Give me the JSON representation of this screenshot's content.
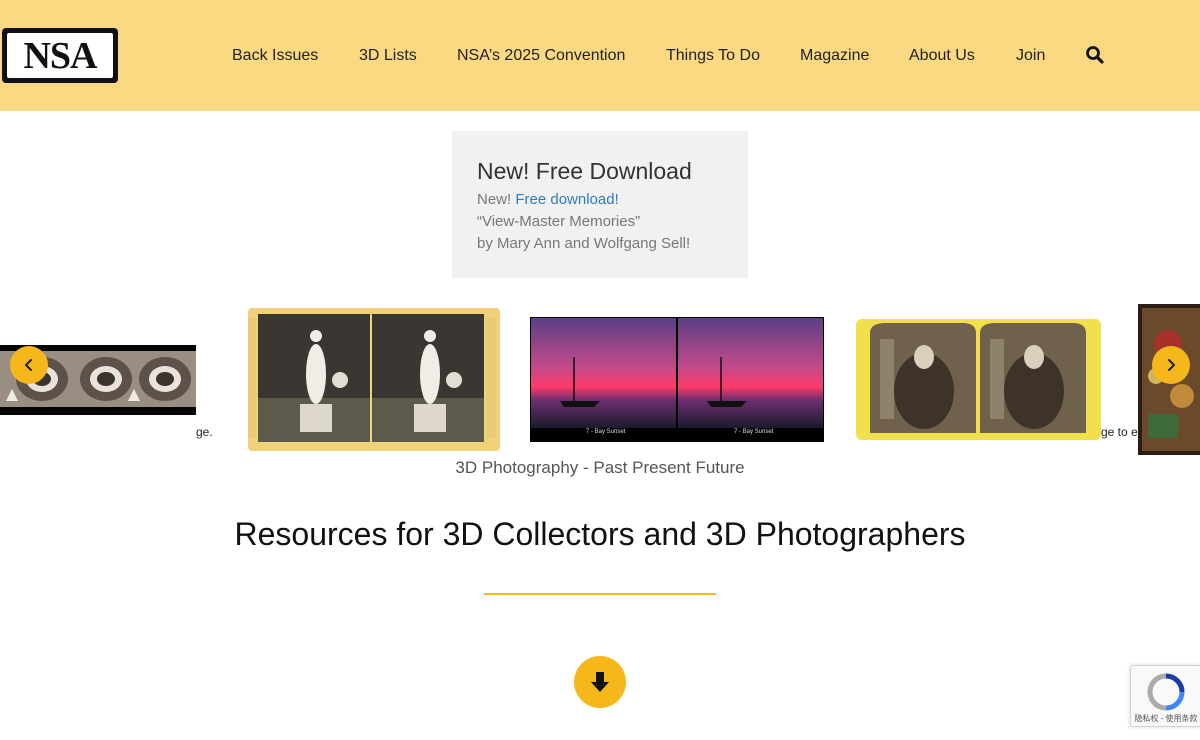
{
  "header": {
    "logo_text": "NSA",
    "nav": [
      {
        "label": "Back Issues"
      },
      {
        "label": "3D Lists"
      },
      {
        "label": "NSA’s 2025 Convention"
      },
      {
        "label": "Things To Do"
      },
      {
        "label": "Magazine"
      },
      {
        "label": "About Us"
      },
      {
        "label": "Join"
      }
    ],
    "search_icon": "search-icon"
  },
  "download": {
    "title": "New! Free Download",
    "line1_prefix": "New! ",
    "line1_link": "Free download!",
    "line2": "“View-Master Memories”",
    "line3": "by Mary Ann and Wolfgang Sell!"
  },
  "carousel": {
    "left_caption_fragment": "ge.",
    "right_caption_fragment": "ge to e",
    "caption": "3D Photography - Past Present Future",
    "prev_icon": "chevron-left-icon",
    "next_icon": "chevron-right-icon",
    "slide3_label_left": "7 - Bay Sunset",
    "slide3_label_right": "7 - Bay Sunset"
  },
  "main": {
    "heading": "Resources for 3D Collectors and 3D Photographers",
    "down_icon": "arrow-down-icon"
  },
  "recaptcha": {
    "text": "隐私权 - 使用条款"
  },
  "colors": {
    "header_bg": "#fbd983",
    "accent": "#f5b719",
    "link": "#2f7bbf"
  }
}
